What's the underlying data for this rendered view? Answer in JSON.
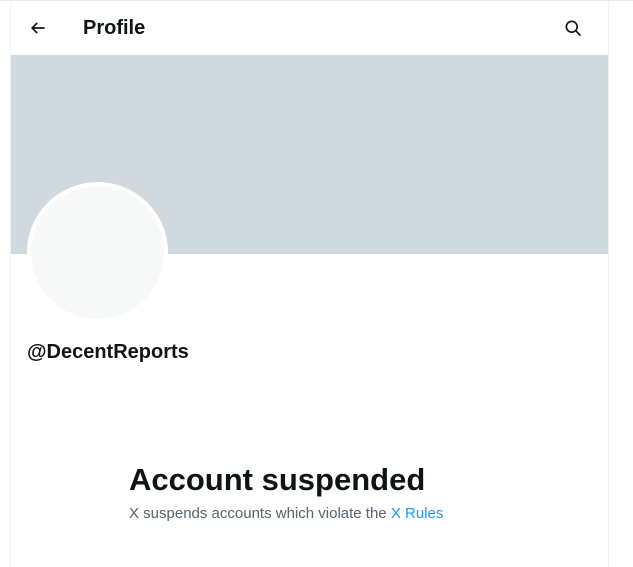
{
  "header": {
    "back_icon": "arrow-left-icon",
    "title": "Profile",
    "search_icon": "search-icon"
  },
  "profile": {
    "handle": "@DecentReports",
    "banner_color": "#cfd9de",
    "avatar_color": "#f7f9f9"
  },
  "suspension": {
    "title": "Account suspended",
    "message": "X suspends accounts which violate the",
    "link_text": "X Rules",
    "link_color": "#1d9bf0"
  }
}
